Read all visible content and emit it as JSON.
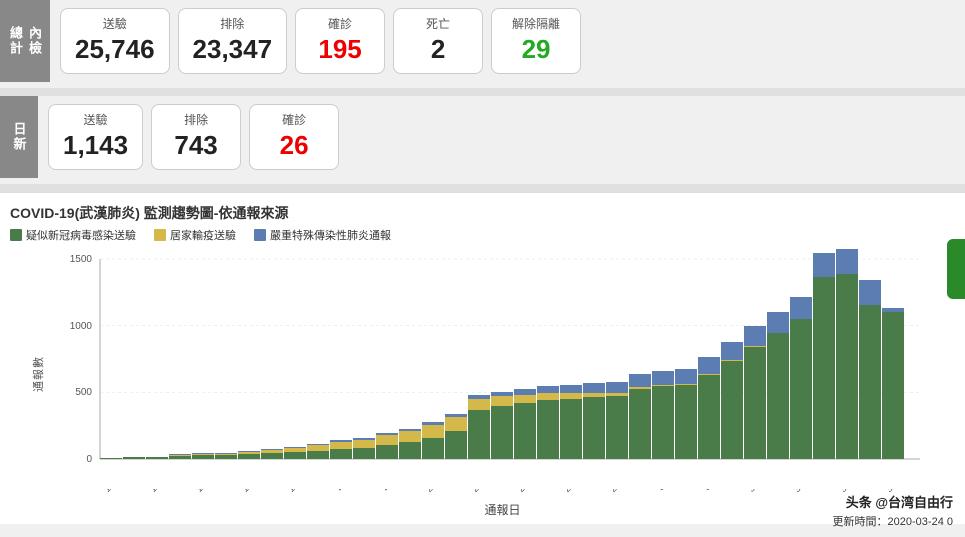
{
  "header": {
    "total_label": "內檢\n總計",
    "daily_label": "日新"
  },
  "total_row": {
    "cards": [
      {
        "label": "送驗",
        "value": "25,746",
        "color": "normal"
      },
      {
        "label": "排除",
        "value": "23,347",
        "color": "normal"
      },
      {
        "label": "確診",
        "value": "195",
        "color": "red"
      },
      {
        "label": "死亡",
        "value": "2",
        "color": "normal"
      },
      {
        "label": "解除隔離",
        "value": "29",
        "color": "green"
      }
    ]
  },
  "daily_row": {
    "cards": [
      {
        "label": "送驗",
        "value": "1,143",
        "color": "normal"
      },
      {
        "label": "排除",
        "value": "743",
        "color": "normal"
      },
      {
        "label": "確診",
        "value": "26",
        "color": "red"
      }
    ]
  },
  "chart": {
    "title": "COVID-19(武漢肺炎) 監測趨勢圖-依通報來源",
    "legend": [
      {
        "label": "疑似新冠病毒感染送驗",
        "color": "#4a7c4a"
      },
      {
        "label": "居家輸疫送驗",
        "color": "#d4b84a"
      },
      {
        "label": "嚴重特殊傳染性肺炎通報",
        "color": "#5b7db1"
      }
    ],
    "y_axis_label": "通報數",
    "x_axis_label": "通報日",
    "y_ticks": [
      0,
      500,
      1000,
      1500
    ],
    "x_labels": [
      "1/15",
      "1/17",
      "1/19",
      "1/21",
      "1/23",
      "1/25",
      "1/27",
      "1/29",
      "1/31",
      "2/2",
      "2/4",
      "2/6",
      "2/8",
      "2/10",
      "2/12",
      "2/14",
      "2/16",
      "2/18",
      "2/20",
      "2/22",
      "2/24",
      "2/26",
      "2/28",
      "3/1",
      "3/3",
      "3/5",
      "3/7",
      "3/9",
      "3/11",
      "3/13",
      "3/15",
      "3/17",
      "3/19",
      "3/21",
      "3/23"
    ],
    "bars": [
      {
        "green": 10,
        "yellow": 0,
        "blue": 2
      },
      {
        "green": 12,
        "yellow": 0,
        "blue": 3
      },
      {
        "green": 14,
        "yellow": 2,
        "blue": 3
      },
      {
        "green": 20,
        "yellow": 5,
        "blue": 4
      },
      {
        "green": 25,
        "yellow": 8,
        "blue": 5
      },
      {
        "green": 30,
        "yellow": 10,
        "blue": 6
      },
      {
        "green": 35,
        "yellow": 15,
        "blue": 6
      },
      {
        "green": 40,
        "yellow": 20,
        "blue": 7
      },
      {
        "green": 50,
        "yellow": 30,
        "blue": 8
      },
      {
        "green": 60,
        "yellow": 40,
        "blue": 10
      },
      {
        "green": 70,
        "yellow": 50,
        "blue": 12
      },
      {
        "green": 80,
        "yellow": 60,
        "blue": 14
      },
      {
        "green": 100,
        "yellow": 70,
        "blue": 15
      },
      {
        "green": 120,
        "yellow": 80,
        "blue": 16
      },
      {
        "green": 150,
        "yellow": 90,
        "blue": 18
      },
      {
        "green": 200,
        "yellow": 100,
        "blue": 20
      },
      {
        "green": 350,
        "yellow": 80,
        "blue": 25
      },
      {
        "green": 380,
        "yellow": 70,
        "blue": 30
      },
      {
        "green": 400,
        "yellow": 60,
        "blue": 40
      },
      {
        "green": 420,
        "yellow": 50,
        "blue": 50
      },
      {
        "green": 430,
        "yellow": 40,
        "blue": 60
      },
      {
        "green": 440,
        "yellow": 30,
        "blue": 70
      },
      {
        "green": 450,
        "yellow": 20,
        "blue": 80
      },
      {
        "green": 500,
        "yellow": 15,
        "blue": 90
      },
      {
        "green": 520,
        "yellow": 10,
        "blue": 100
      },
      {
        "green": 530,
        "yellow": 8,
        "blue": 110
      },
      {
        "green": 600,
        "yellow": 6,
        "blue": 120
      },
      {
        "green": 700,
        "yellow": 5,
        "blue": 130
      },
      {
        "green": 800,
        "yellow": 4,
        "blue": 140
      },
      {
        "green": 900,
        "yellow": 3,
        "blue": 150
      },
      {
        "green": 1000,
        "yellow": 2,
        "blue": 160
      },
      {
        "green": 1300,
        "yellow": 1,
        "blue": 170
      },
      {
        "green": 1350,
        "yellow": 1,
        "blue": 175
      },
      {
        "green": 1100,
        "yellow": 1,
        "blue": 180
      },
      {
        "green": 1050,
        "yellow": 0,
        "blue": 30
      }
    ]
  },
  "watermark": "头条 @台湾自由行",
  "timestamp": "更新時間：2020-03-24 0"
}
